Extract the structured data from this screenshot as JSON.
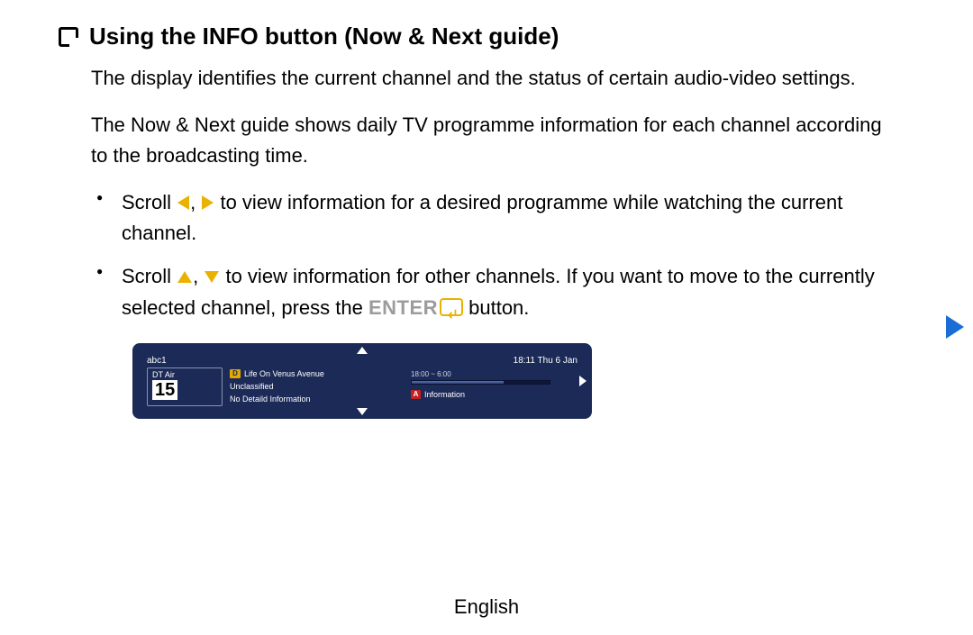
{
  "heading": "Using the INFO button (Now & Next guide)",
  "para1": "The display identifies the current channel and the status of certain audio-video settings.",
  "para2": "The Now & Next guide shows daily TV programme information for each channel according to the broadcasting time.",
  "bullet1": {
    "pre": "Scroll ",
    "mid": ", ",
    "post": " to view information for a desired programme while watching the current channel."
  },
  "bullet2": {
    "pre": "Scroll ",
    "mid1": ", ",
    "mid2": " to view information for other channels. If you want to move to the currently selected channel, press the ",
    "enter": "ENTER",
    "post": " button."
  },
  "osd": {
    "channel_name": "abc1",
    "clock": "18:11 Thu 6 Jan",
    "source": "DT Air",
    "channel_number": "15",
    "programme_title": "Life On Venus Avenue",
    "rating": "Unclassified",
    "detail": "No Detaild Information",
    "time_range": "18:00 ~ 6:00",
    "info_label": "Information",
    "d_badge": "D",
    "a_badge": "A"
  },
  "footer": "English"
}
